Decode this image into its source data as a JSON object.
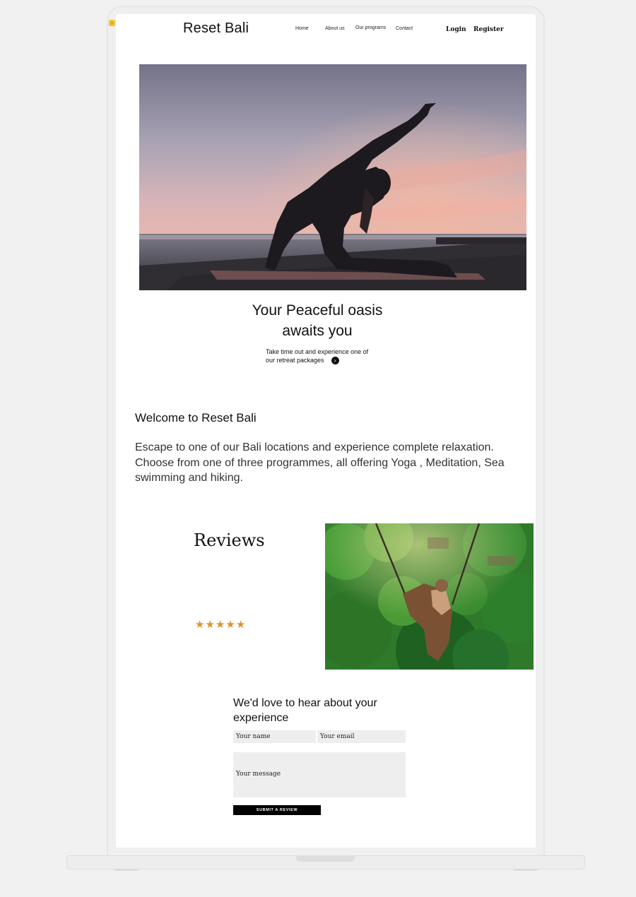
{
  "header": {
    "logo": "Reset Bali",
    "nav": [
      "Home",
      "About us",
      "Our programs",
      "Contact"
    ],
    "login": "Login",
    "register": "Register"
  },
  "hero": {
    "image_icon": "yoga-silhouette-sunset-image",
    "title_line1": "Your Peaceful oasis",
    "title_line2": "awaits you",
    "subtitle_line1": "Take time out and experience one of",
    "subtitle_line2": "our retreat packages",
    "arrow_icon": "chevron-right-icon"
  },
  "welcome": {
    "title": "Welcome to Reset Bali",
    "text": "Escape to one of our Bali locations and experience complete relaxation. Choose from one of three programmes, all offering Yoga , Meditation, Sea swimming and hiking."
  },
  "reviews": {
    "title": "Reviews",
    "rating": 5,
    "rating_max": 5,
    "star_color": "#e0912a",
    "image_icon": "jungle-swing-image"
  },
  "form": {
    "title": "We'd love to hear about your experience",
    "name_placeholder": "Your name",
    "email_placeholder": "Your email",
    "message_placeholder": "Your message",
    "submit_label": "SUBMIT A REVIEW"
  }
}
